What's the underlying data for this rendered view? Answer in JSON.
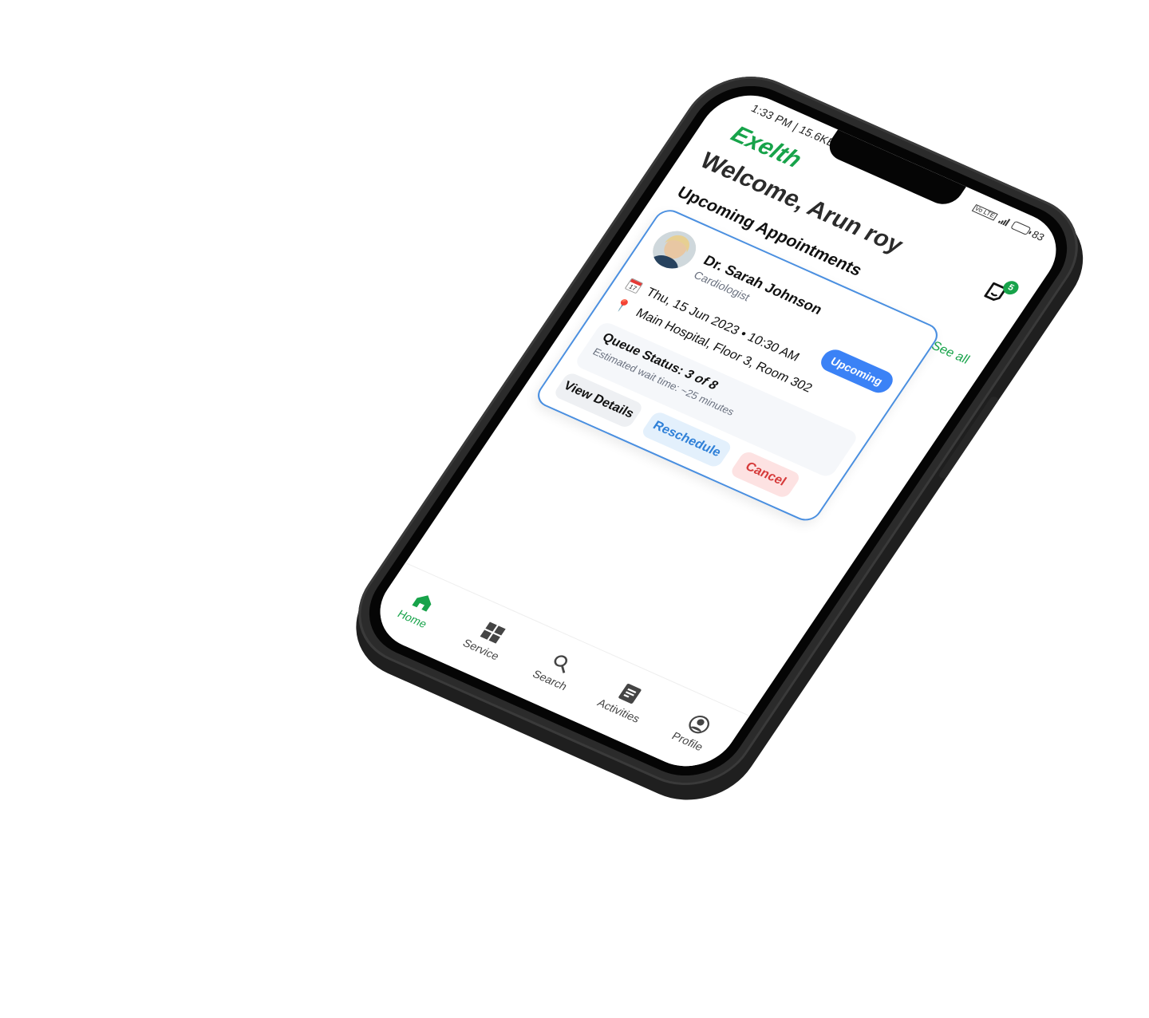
{
  "status_bar": {
    "time_speed": "1:33 PM | 15.6KB/s",
    "battery_percent": "83",
    "network": "Vo LTE",
    "battery_level": 0.83
  },
  "app": {
    "brand": "Exelth",
    "welcome": "Welcome, Arun roy",
    "notification_count": "5"
  },
  "appointments": {
    "section_title": "Upcoming Appointments",
    "see_all": "See all",
    "card": {
      "doctor_name": "Dr. Sarah Johnson",
      "specialty": "Cardiologist",
      "status_badge": "Upcoming",
      "calendar_day": "17",
      "datetime": "Thu, 15 Jun 2023 • 10:30 AM",
      "location": "Main Hospital, Floor 3, Room 302",
      "queue_label": "Queue Status:",
      "queue_value": "3 of 8",
      "wait_time": "Estimated wait time: ~25 minutes",
      "buttons": {
        "view": "View Details",
        "reschedule": "Reschedule",
        "cancel": "Cancel"
      }
    }
  },
  "tabbar": {
    "items": [
      {
        "label": "Home",
        "icon": "home-icon",
        "active": true
      },
      {
        "label": "Service",
        "icon": "grid-icon",
        "active": false
      },
      {
        "label": "Search",
        "icon": "search-icon",
        "active": false
      },
      {
        "label": "Activities",
        "icon": "activities-icon",
        "active": false
      },
      {
        "label": "Profile",
        "icon": "profile-icon",
        "active": false
      }
    ]
  },
  "colors": {
    "brand_green": "#17a34a",
    "accent_blue": "#3b82f6",
    "cancel_red": "#d63b3b",
    "phone_frame": "#2b2b2b"
  }
}
